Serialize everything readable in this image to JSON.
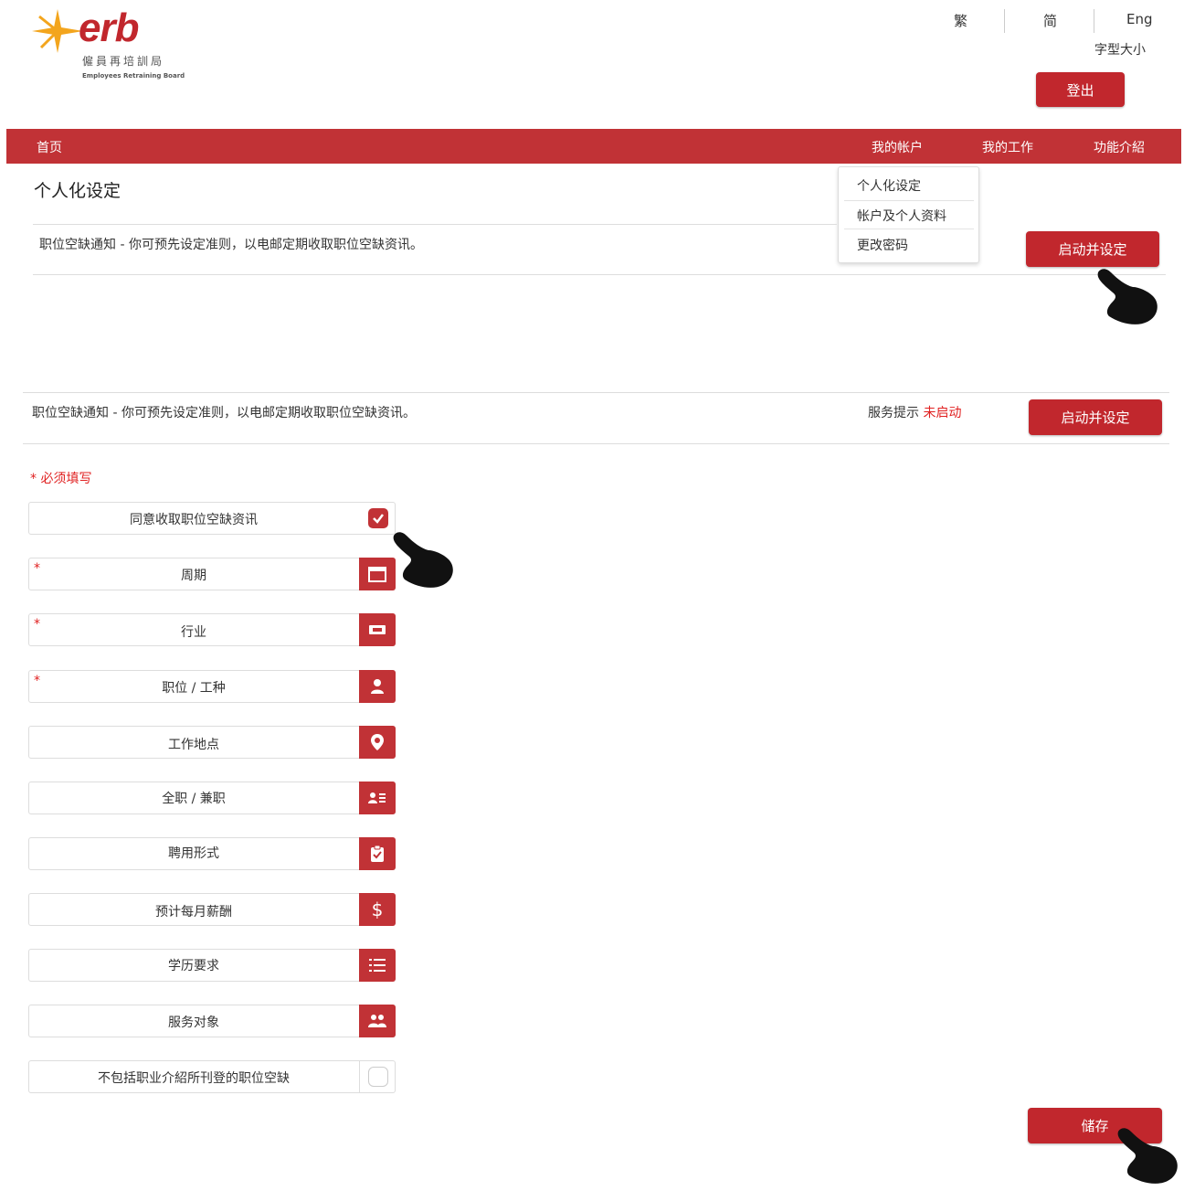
{
  "header": {
    "logo_text": "erb",
    "logo_cn": "僱員再培訓局",
    "logo_en": "Employees Retraining Board",
    "lang_trad": "繁",
    "lang_simp": "简",
    "lang_eng": "Eng",
    "font_size": "字型大小",
    "logout": "登出"
  },
  "nav": {
    "home": "首页",
    "my_account": "我的帐户",
    "my_jobs": "我的工作",
    "features": "功能介紹"
  },
  "dropdown": {
    "items": [
      "个人化设定",
      "帐户及个人资料",
      "更改密码"
    ]
  },
  "page_title": "个人化设定",
  "section1": {
    "text": "职位空缺通知 - 你可预先设定准则，以电邮定期收取职位空缺资讯。",
    "button": "启动并设定"
  },
  "section2": {
    "text": "职位空缺通知 - 你可预先设定准则，以电邮定期收取职位空缺资讯。",
    "status_label": "服务提示",
    "status_value": "未启动",
    "button": "启动并设定"
  },
  "required_note": "* 必须填写",
  "fields": [
    {
      "label": "同意收取职位空缺资讯",
      "required": false,
      "icon": "checkbox-checked-icon"
    },
    {
      "label": "周期",
      "required": true,
      "icon": "calendar-icon"
    },
    {
      "label": "行业",
      "required": true,
      "icon": "industry-icon"
    },
    {
      "label": "职位 / 工种",
      "required": true,
      "icon": "user-icon"
    },
    {
      "label": "工作地点",
      "required": false,
      "icon": "map-pin-icon"
    },
    {
      "label": "全职 / 兼职",
      "required": false,
      "icon": "id-card-icon"
    },
    {
      "label": "聘用形式",
      "required": false,
      "icon": "clipboard-icon"
    },
    {
      "label": "预计每月薪酬",
      "required": false,
      "icon": "dollar-icon"
    },
    {
      "label": "学历要求",
      "required": false,
      "icon": "list-icon"
    },
    {
      "label": "服务对象",
      "required": false,
      "icon": "users-icon"
    },
    {
      "label": "不包括职业介紹所刊登的职位空缺",
      "required": false,
      "icon": "checkbox-empty-icon"
    }
  ],
  "required_mark": "*",
  "save_button": "储存",
  "colors": {
    "brand": "#c13236",
    "required": "#e02020"
  }
}
